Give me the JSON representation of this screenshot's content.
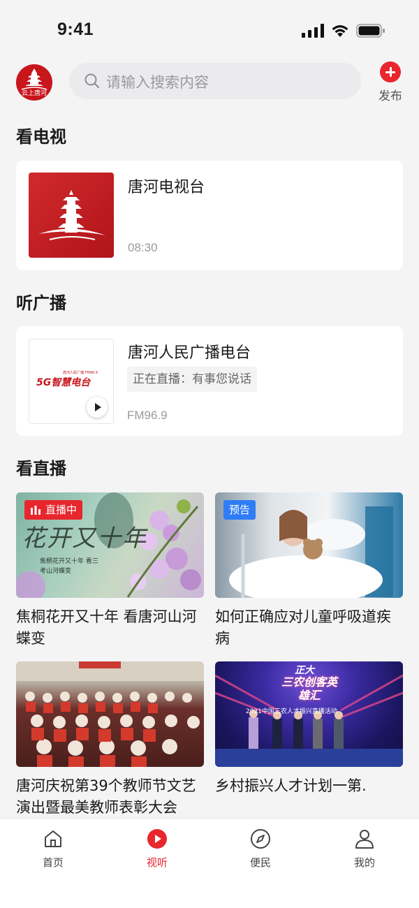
{
  "status_bar": {
    "time": "9:41"
  },
  "header": {
    "logo_text": "云上唐河",
    "search_placeholder": "请输入搜索内容",
    "publish_label": "发布"
  },
  "sections": {
    "tv": "看电视",
    "radio": "听广播",
    "live": "看直播"
  },
  "tv_card": {
    "title": "唐河电视台",
    "time": "08:30"
  },
  "radio_card": {
    "title": "唐河人民广播电台",
    "live_status": "正在直播：有事您说话",
    "frequency": "FM96.9",
    "logo_text": "5G智慧电台",
    "logo_sub": "唐河人民广播 FM96.9"
  },
  "live_items": [
    {
      "title": "焦桐花开又十年 看唐河山河蝶变",
      "badge": "直播中",
      "badge_type": "live",
      "poster_title": "花开又十年",
      "poster_sub": "焦桐花开又十年 看三考山河蝶变"
    },
    {
      "title": "如何正确应对儿童呼吸道疾病",
      "badge": "预告",
      "badge_type": "preview"
    },
    {
      "title": "唐河庆祝第39个教师节文艺演出暨最美教师表彰大会",
      "badge": ""
    },
    {
      "title": "乡村振兴人才计划一第.",
      "badge": "",
      "poster_title": "三农创客英雄汇",
      "poster_top": "正大",
      "poster_sub": "2021中国三农人才振兴直播活动"
    }
  ],
  "tabbar": [
    {
      "label": "首页",
      "icon": "home-icon",
      "active": false
    },
    {
      "label": "视听",
      "icon": "play-circle-icon",
      "active": true
    },
    {
      "label": "便民",
      "icon": "compass-icon",
      "active": false
    },
    {
      "label": "我的",
      "icon": "user-icon",
      "active": false
    }
  ],
  "colors": {
    "brand_red": "#e8262d",
    "preview_blue": "#2f7df6",
    "background": "#f4f4f5"
  }
}
